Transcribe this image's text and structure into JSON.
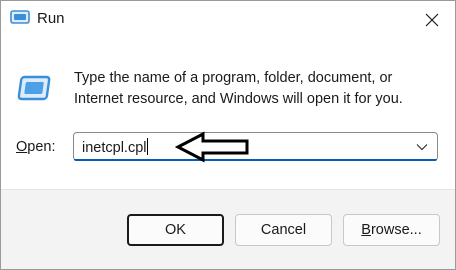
{
  "window": {
    "title": "Run"
  },
  "message": "Type the name of a program, folder, document, or Internet resource, and Windows will open it for you.",
  "open": {
    "label_mnemonic": "O",
    "label_rest": "pen:",
    "value": "inetcpl.cpl"
  },
  "buttons": {
    "ok": "OK",
    "cancel": "Cancel",
    "browse_mnemonic": "B",
    "browse_rest": "rowse..."
  },
  "colors": {
    "accent": "#005fb8",
    "icon_blue": "#3a8fd9"
  },
  "icons": {
    "title": "run-icon",
    "close": "close-icon",
    "dropdown": "chevron-down-icon",
    "annotation": "left-arrow-icon"
  }
}
